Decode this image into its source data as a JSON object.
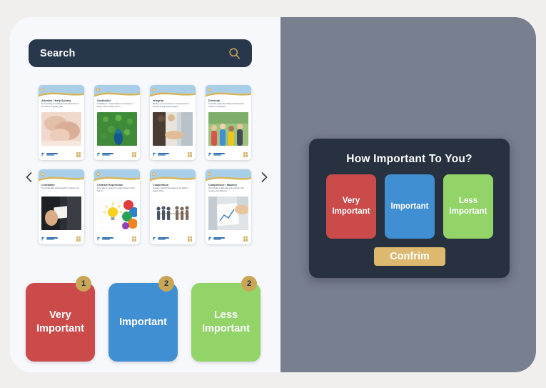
{
  "app": {
    "background_color": "#f0efee",
    "panel_color": "#f7f8fc",
    "overlay_color": "#787f8f",
    "accent_gold": "#dcb96e",
    "navy": "#27313f"
  },
  "search": {
    "placeholder": "Search",
    "value": "",
    "icon": "search-icon",
    "icon_color": "#c9a558",
    "background": "#29374c"
  },
  "carousel": {
    "prev_label": "‹",
    "next_label": "›",
    "prev_icon": "chevron-left-icon",
    "next_icon": "chevron-right-icon",
    "cards": [
      {
        "title": "Altruism / Help Society",
        "description": "Do something to contribute to the betterment of the world or a greater good",
        "image": "holding-hands-photo"
      },
      {
        "title": "Aesthetics",
        "description": "Sensitivity to, or appreciation of, the beauty of things, nature, design and art",
        "image": "peacock-photo"
      },
      {
        "title": "Integrity",
        "description": "Meeting your commitments, being honest and having a strong moral principles",
        "image": "handshake-photo"
      },
      {
        "title": "Diversity",
        "description": "To include people from different backgrounds, cultures or viewpoints",
        "image": "group-of-people-photo"
      },
      {
        "title": "Credibility",
        "description": "To be believable and trustworthy in what you do",
        "image": "business-card-photo"
      },
      {
        "title": "Creative Expression",
        "description": "To be able to express my creative ideas in word and art",
        "image": "lightbulb-colors-photo"
      },
      {
        "title": "Competition",
        "description": "Engage in activity that measures my abilities against others",
        "image": "tug-of-war-photo"
      },
      {
        "title": "Competence / Mastery",
        "description": "Demonstrate a high degree of expertise, skill mastery and proficiency",
        "image": "desk-charts-photo"
      }
    ]
  },
  "buckets": [
    {
      "label": "Very\nImportant",
      "count": "1",
      "color": "#cb4b4b"
    },
    {
      "label": "Important",
      "count": "2",
      "color": "#3f8fd2"
    },
    {
      "label": "Less\nImportant",
      "count": "2",
      "color": "#92d468"
    }
  ],
  "modal": {
    "title": "How Important To You?",
    "options": [
      {
        "label": "Very\nImportant",
        "color": "#cb4b4b"
      },
      {
        "label": "Important",
        "color": "#3f8fd2"
      },
      {
        "label": "Less\nImportant",
        "color": "#92d468"
      }
    ],
    "confirm_label": "Confrim"
  }
}
